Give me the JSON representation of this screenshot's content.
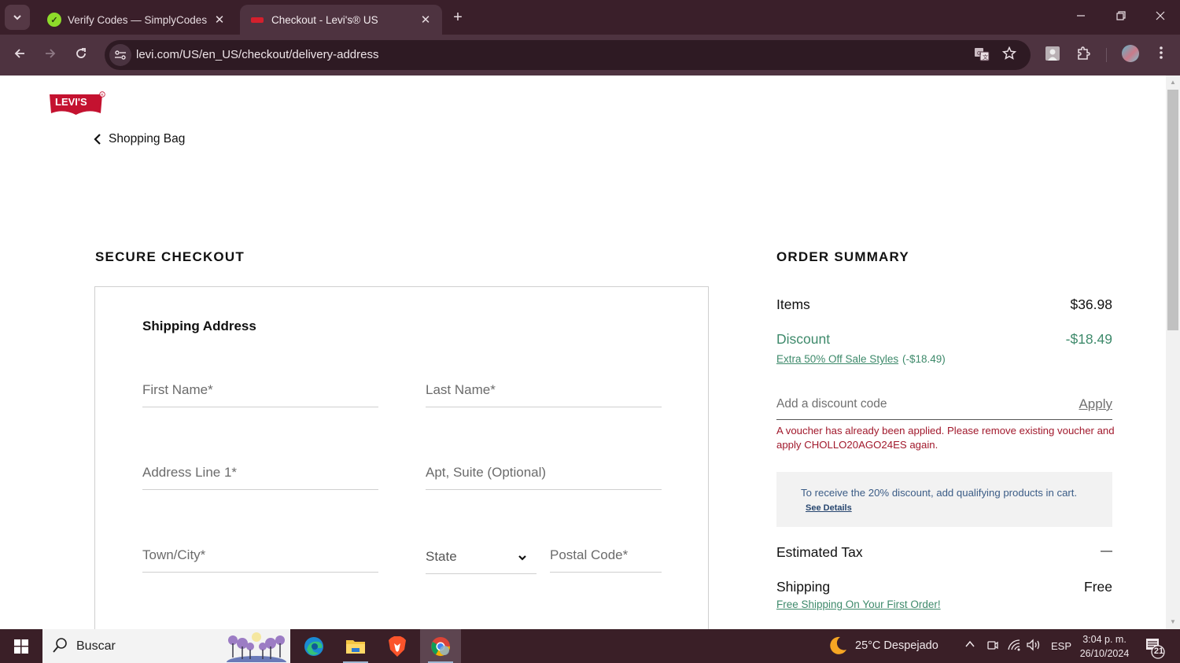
{
  "browser": {
    "tabs": [
      {
        "title": "Verify Codes — SimplyCodes",
        "active": false,
        "favicon": "simplycodes-check-icon"
      },
      {
        "title": "Checkout - Levi's® US",
        "active": true,
        "favicon": "levis-flag-icon"
      }
    ],
    "url": "levi.com/US/en_US/checkout/delivery-address",
    "icons": {
      "tab_search": "chevron-down-icon",
      "new_tab": "+",
      "minimize": "–",
      "restore": "❐",
      "close": "✕",
      "back": "←",
      "forward": "→",
      "reload": "↻",
      "tab_close": "✕"
    }
  },
  "page": {
    "logo_text": "LEVI'S",
    "back_link": "Shopping Bag",
    "checkout": {
      "title": "SECURE CHECKOUT",
      "section_heading": "Shipping Address",
      "fields": {
        "first_name": {
          "label": "First Name*",
          "value": ""
        },
        "last_name": {
          "label": "Last Name*",
          "value": ""
        },
        "address1": {
          "label": "Address Line 1*",
          "value": ""
        },
        "apt": {
          "label": "Apt, Suite (Optional)",
          "value": ""
        },
        "city": {
          "label": "Town/City*",
          "value": ""
        },
        "state": {
          "label": "State",
          "selected": "State"
        },
        "postal": {
          "label": "Postal Code*",
          "value": ""
        }
      }
    },
    "summary": {
      "title": "ORDER SUMMARY",
      "items_label": "Items",
      "items_value": "$36.98",
      "discount_label": "Discount",
      "discount_value": "-$18.49",
      "promo_link": "Extra 50% Off Sale Styles",
      "promo_amount": "(-$18.49)",
      "discount_code_placeholder": "Add a discount code",
      "apply_label": "Apply",
      "error_message": "A voucher has already been applied. Please remove existing voucher and apply CHOLLO20AGO24ES again.",
      "info_message": "To receive the 20% discount, add qualifying products in cart.",
      "see_details": "See Details",
      "tax_label": "Estimated Tax",
      "tax_value": "—",
      "shipping_label": "Shipping",
      "shipping_value": "Free",
      "shipping_link": "Free Shipping On Your First Order!"
    },
    "colors": {
      "brand_red": "#c41230",
      "discount_green": "#3e8a6b",
      "error_red": "#a1192c",
      "info_blue": "#3b5c86"
    }
  },
  "taskbar": {
    "search_placeholder": "Buscar",
    "apps": [
      "edge-icon",
      "file-explorer-icon",
      "brave-icon",
      "chrome-icon"
    ],
    "weather": "25°C  Despejado",
    "language": "ESP",
    "time": "3:04 p. m.",
    "date": "26/10/2024",
    "notification_count": "21"
  }
}
